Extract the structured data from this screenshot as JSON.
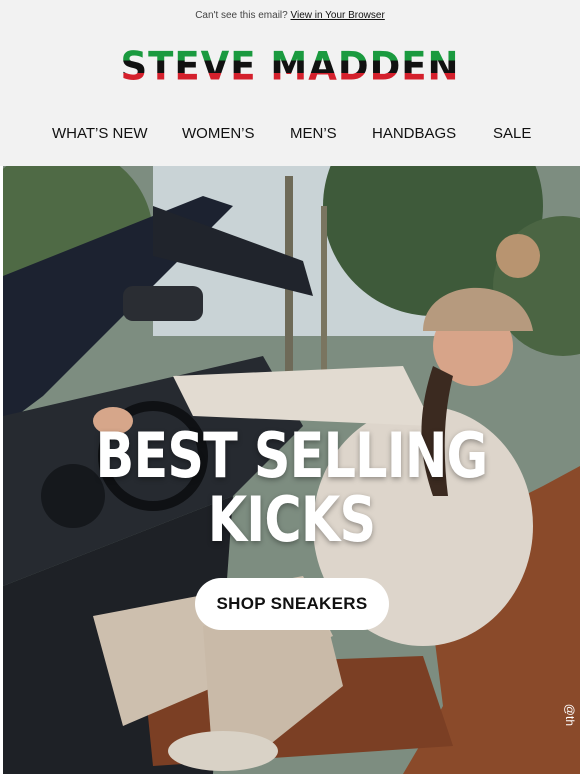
{
  "preheader": {
    "text": "Can't see this email?",
    "link": "View in Your Browser"
  },
  "brand": {
    "name": "STEVE MADDEN",
    "colors": [
      "#1a9a3f",
      "#111111",
      "#d4202c"
    ]
  },
  "nav": {
    "items": [
      {
        "label": "WHAT’S NEW"
      },
      {
        "label": "WOMEN’S"
      },
      {
        "label": "MEN’S"
      },
      {
        "label": "HANDBAGS"
      },
      {
        "label": "SALE"
      }
    ]
  },
  "hero": {
    "headline_line1": "BEST SELLING",
    "headline_line2": "KICKS",
    "cta_label": "SHOP SNEAKERS",
    "credit": "@th"
  }
}
